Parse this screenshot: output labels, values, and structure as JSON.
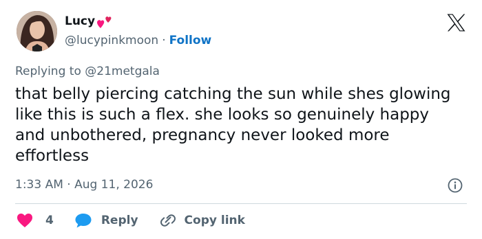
{
  "author": {
    "display_name": "Lucy",
    "handle": "@lucypinkmoon",
    "separator": "·",
    "follow_label": "Follow",
    "emoji": "two-hearts"
  },
  "reply": {
    "prefix": "Replying to",
    "mention": "@21metgala"
  },
  "tweet": {
    "text": "that belly piercing catching the sun while shes glowing like this is such a flex. she looks so genuinely happy and unbothered, pregnancy never looked more effortless"
  },
  "meta": {
    "timestamp": "1:33 AM · Aug 11, 2026"
  },
  "actions": {
    "like_count": "4",
    "reply_label": "Reply",
    "copy_link_label": "Copy link"
  },
  "icons": {
    "logo": "x-logo",
    "info": "info-icon",
    "like": "heart-icon",
    "reply": "chat-bubble-icon",
    "copy": "link-icon"
  },
  "colors": {
    "text": "#0f1419",
    "muted": "#536471",
    "follow": "#0f73c6",
    "heart": "#f91880",
    "reply_bubble": "#1d9bf0",
    "divider": "#cfd9de"
  }
}
